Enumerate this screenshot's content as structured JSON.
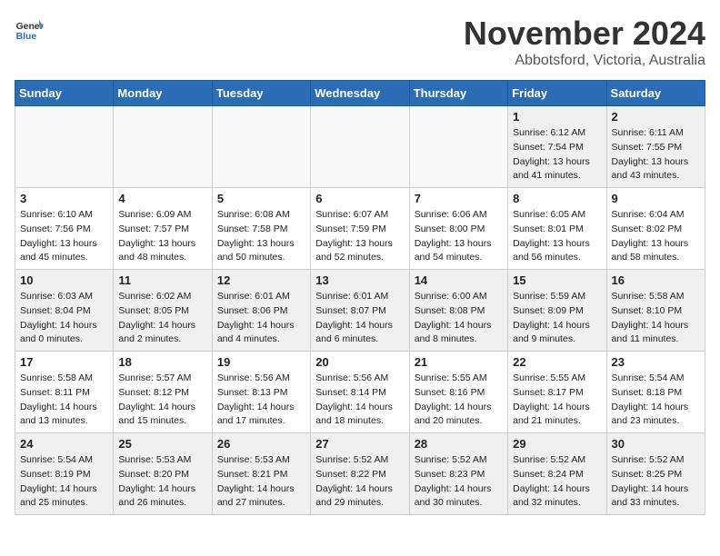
{
  "header": {
    "logo_general": "General",
    "logo_blue": "Blue",
    "month": "November 2024",
    "location": "Abbotsford, Victoria, Australia"
  },
  "weekdays": [
    "Sunday",
    "Monday",
    "Tuesday",
    "Wednesday",
    "Thursday",
    "Friday",
    "Saturday"
  ],
  "weeks": [
    [
      {
        "day": "",
        "empty": true
      },
      {
        "day": "",
        "empty": true
      },
      {
        "day": "",
        "empty": true
      },
      {
        "day": "",
        "empty": true
      },
      {
        "day": "",
        "empty": true
      },
      {
        "day": "1",
        "sunrise": "6:12 AM",
        "sunset": "7:54 PM",
        "daylight": "13 hours and 41 minutes."
      },
      {
        "day": "2",
        "sunrise": "6:11 AM",
        "sunset": "7:55 PM",
        "daylight": "13 hours and 43 minutes."
      }
    ],
    [
      {
        "day": "3",
        "sunrise": "6:10 AM",
        "sunset": "7:56 PM",
        "daylight": "13 hours and 45 minutes."
      },
      {
        "day": "4",
        "sunrise": "6:09 AM",
        "sunset": "7:57 PM",
        "daylight": "13 hours and 48 minutes."
      },
      {
        "day": "5",
        "sunrise": "6:08 AM",
        "sunset": "7:58 PM",
        "daylight": "13 hours and 50 minutes."
      },
      {
        "day": "6",
        "sunrise": "6:07 AM",
        "sunset": "7:59 PM",
        "daylight": "13 hours and 52 minutes."
      },
      {
        "day": "7",
        "sunrise": "6:06 AM",
        "sunset": "8:00 PM",
        "daylight": "13 hours and 54 minutes."
      },
      {
        "day": "8",
        "sunrise": "6:05 AM",
        "sunset": "8:01 PM",
        "daylight": "13 hours and 56 minutes."
      },
      {
        "day": "9",
        "sunrise": "6:04 AM",
        "sunset": "8:02 PM",
        "daylight": "13 hours and 58 minutes."
      }
    ],
    [
      {
        "day": "10",
        "sunrise": "6:03 AM",
        "sunset": "8:04 PM",
        "daylight": "14 hours and 0 minutes."
      },
      {
        "day": "11",
        "sunrise": "6:02 AM",
        "sunset": "8:05 PM",
        "daylight": "14 hours and 2 minutes."
      },
      {
        "day": "12",
        "sunrise": "6:01 AM",
        "sunset": "8:06 PM",
        "daylight": "14 hours and 4 minutes."
      },
      {
        "day": "13",
        "sunrise": "6:01 AM",
        "sunset": "8:07 PM",
        "daylight": "14 hours and 6 minutes."
      },
      {
        "day": "14",
        "sunrise": "6:00 AM",
        "sunset": "8:08 PM",
        "daylight": "14 hours and 8 minutes."
      },
      {
        "day": "15",
        "sunrise": "5:59 AM",
        "sunset": "8:09 PM",
        "daylight": "14 hours and 9 minutes."
      },
      {
        "day": "16",
        "sunrise": "5:58 AM",
        "sunset": "8:10 PM",
        "daylight": "14 hours and 11 minutes."
      }
    ],
    [
      {
        "day": "17",
        "sunrise": "5:58 AM",
        "sunset": "8:11 PM",
        "daylight": "14 hours and 13 minutes."
      },
      {
        "day": "18",
        "sunrise": "5:57 AM",
        "sunset": "8:12 PM",
        "daylight": "14 hours and 15 minutes."
      },
      {
        "day": "19",
        "sunrise": "5:56 AM",
        "sunset": "8:13 PM",
        "daylight": "14 hours and 17 minutes."
      },
      {
        "day": "20",
        "sunrise": "5:56 AM",
        "sunset": "8:14 PM",
        "daylight": "14 hours and 18 minutes."
      },
      {
        "day": "21",
        "sunrise": "5:55 AM",
        "sunset": "8:16 PM",
        "daylight": "14 hours and 20 minutes."
      },
      {
        "day": "22",
        "sunrise": "5:55 AM",
        "sunset": "8:17 PM",
        "daylight": "14 hours and 21 minutes."
      },
      {
        "day": "23",
        "sunrise": "5:54 AM",
        "sunset": "8:18 PM",
        "daylight": "14 hours and 23 minutes."
      }
    ],
    [
      {
        "day": "24",
        "sunrise": "5:54 AM",
        "sunset": "8:19 PM",
        "daylight": "14 hours and 25 minutes."
      },
      {
        "day": "25",
        "sunrise": "5:53 AM",
        "sunset": "8:20 PM",
        "daylight": "14 hours and 26 minutes."
      },
      {
        "day": "26",
        "sunrise": "5:53 AM",
        "sunset": "8:21 PM",
        "daylight": "14 hours and 27 minutes."
      },
      {
        "day": "27",
        "sunrise": "5:52 AM",
        "sunset": "8:22 PM",
        "daylight": "14 hours and 29 minutes."
      },
      {
        "day": "28",
        "sunrise": "5:52 AM",
        "sunset": "8:23 PM",
        "daylight": "14 hours and 30 minutes."
      },
      {
        "day": "29",
        "sunrise": "5:52 AM",
        "sunset": "8:24 PM",
        "daylight": "14 hours and 32 minutes."
      },
      {
        "day": "30",
        "sunrise": "5:52 AM",
        "sunset": "8:25 PM",
        "daylight": "14 hours and 33 minutes."
      }
    ]
  ]
}
